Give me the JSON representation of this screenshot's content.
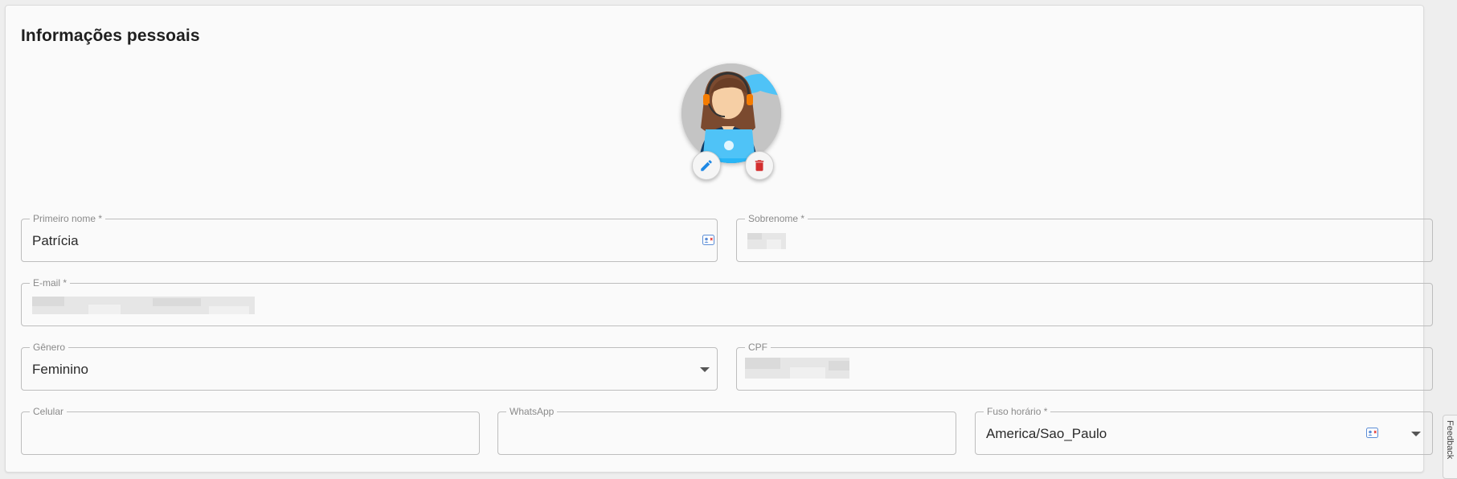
{
  "section": {
    "title": "Informações pessoais"
  },
  "avatar": {
    "edit_icon": "pencil-icon",
    "delete_icon": "trash-icon"
  },
  "form": {
    "first_name": {
      "label": "Primeiro nome *",
      "value": "Patrícia"
    },
    "last_name": {
      "label": "Sobrenome *",
      "value": ""
    },
    "email": {
      "label": "E-mail *",
      "value": ""
    },
    "gender": {
      "label": "Gênero",
      "value": "Feminino"
    },
    "cpf": {
      "label": "CPF",
      "value": ""
    },
    "cellphone": {
      "label": "Celular",
      "value": ""
    },
    "whatsapp": {
      "label": "WhatsApp",
      "value": ""
    },
    "timezone": {
      "label": "Fuso horário *",
      "value": "America/Sao_Paulo"
    }
  },
  "feedback": {
    "label": "Feedback"
  },
  "colors": {
    "edit": "#1e88e5",
    "delete": "#d32f2f",
    "avatar_bg": "#c4c4c4"
  }
}
